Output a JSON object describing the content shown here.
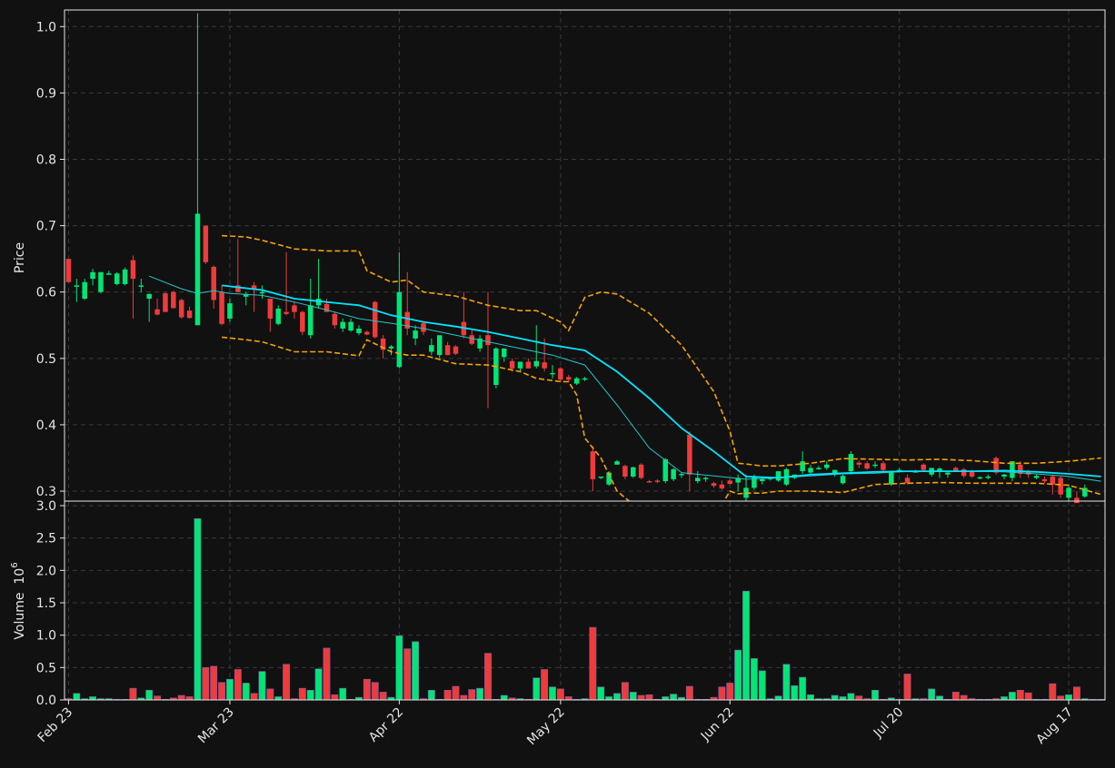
{
  "chart_data": [
    {
      "type": "candlestick",
      "panel": "price",
      "ylabel": "Price",
      "ylim": [
        0.285,
        1.025
      ],
      "yticks": [
        0.3,
        0.4,
        0.5,
        0.6,
        0.7,
        0.8,
        0.9,
        1.0
      ],
      "ytick_labels": [
        "0.3",
        "0.4",
        "0.5",
        "0.6",
        "0.7",
        "0.8",
        "0.9",
        "1.0"
      ],
      "xlim": [
        -0.5,
        128.5
      ],
      "xtick_index": [
        0,
        20,
        41,
        61,
        82,
        103,
        124
      ],
      "xtick_labels": [
        "Feb 23",
        "Mar 23",
        "Apr 22",
        "May 22",
        "Jun 22",
        "Jul 20",
        "Aug 17"
      ],
      "grid": true,
      "colors": {
        "background": "#111111",
        "up": "#00e676",
        "down": "#ef3b3b",
        "grid": "#3a3a3a",
        "frame": "#e6e6e6",
        "text": "#e6e6e6",
        "ma_fast": "#26c6c6",
        "ma_slow": "#00e5ff",
        "band": "#f5a300"
      },
      "ohlc": [
        [
          0.65,
          0.65,
          0.615,
          0.615
        ],
        [
          0.61,
          0.62,
          0.585,
          0.61
        ],
        [
          0.59,
          0.62,
          0.588,
          0.615
        ],
        [
          0.62,
          0.635,
          0.61,
          0.63
        ],
        [
          0.6,
          0.63,
          0.598,
          0.63
        ],
        [
          0.628,
          0.632,
          0.626,
          0.628
        ],
        [
          0.612,
          0.63,
          0.61,
          0.628
        ],
        [
          0.612,
          0.637,
          0.61,
          0.634
        ],
        [
          0.648,
          0.655,
          0.56,
          0.62
        ],
        [
          0.61,
          0.62,
          0.6,
          0.61
        ],
        [
          0.59,
          0.598,
          0.555,
          0.597
        ],
        [
          0.574,
          0.59,
          0.565,
          0.566
        ],
        [
          0.598,
          0.6,
          0.57,
          0.57
        ],
        [
          0.6,
          0.602,
          0.575,
          0.576
        ],
        [
          0.588,
          0.59,
          0.56,
          0.562
        ],
        [
          0.572,
          0.578,
          0.56,
          0.561
        ],
        [
          0.55,
          1.02,
          0.55,
          0.718
        ],
        [
          0.7,
          0.7,
          0.642,
          0.645
        ],
        [
          0.638,
          0.64,
          0.575,
          0.588
        ],
        [
          0.6,
          0.61,
          0.55,
          0.552
        ],
        [
          0.56,
          0.59,
          0.555,
          0.583
        ],
        [
          0.61,
          0.68,
          0.6,
          0.6
        ],
        [
          0.593,
          0.6,
          0.58,
          0.597
        ],
        [
          0.61,
          0.615,
          0.57,
          0.605
        ],
        [
          0.6,
          0.61,
          0.59,
          0.6
        ],
        [
          0.59,
          0.59,
          0.54,
          0.56
        ],
        [
          0.552,
          0.58,
          0.55,
          0.575
        ],
        [
          0.57,
          0.66,
          0.565,
          0.567
        ],
        [
          0.58,
          0.585,
          0.56,
          0.57
        ],
        [
          0.57,
          0.572,
          0.535,
          0.54
        ],
        [
          0.535,
          0.62,
          0.53,
          0.58
        ],
        [
          0.58,
          0.65,
          0.575,
          0.59
        ],
        [
          0.582,
          0.59,
          0.57,
          0.57
        ],
        [
          0.567,
          0.57,
          0.545,
          0.55
        ],
        [
          0.545,
          0.56,
          0.54,
          0.555
        ],
        [
          0.542,
          0.56,
          0.54,
          0.555
        ],
        [
          0.538,
          0.55,
          0.535,
          0.545
        ],
        [
          0.54,
          0.542,
          0.535,
          0.536
        ],
        [
          0.585,
          0.587,
          0.53,
          0.532
        ],
        [
          0.53,
          0.535,
          0.5,
          0.513
        ],
        [
          0.515,
          0.52,
          0.505,
          0.518
        ],
        [
          0.487,
          0.66,
          0.485,
          0.6
        ],
        [
          0.57,
          0.63,
          0.535,
          0.545
        ],
        [
          0.53,
          0.55,
          0.52,
          0.542
        ],
        [
          0.553,
          0.556,
          0.535,
          0.54
        ],
        [
          0.51,
          0.53,
          0.505,
          0.52
        ],
        [
          0.505,
          0.52,
          0.5,
          0.535
        ],
        [
          0.52,
          0.525,
          0.505,
          0.505
        ],
        [
          0.518,
          0.52,
          0.505,
          0.507
        ],
        [
          0.555,
          0.6,
          0.53,
          0.535
        ],
        [
          0.535,
          0.545,
          0.52,
          0.522
        ],
        [
          0.515,
          0.535,
          0.51,
          0.53
        ],
        [
          0.535,
          0.6,
          0.425,
          0.52
        ],
        [
          0.46,
          0.517,
          0.455,
          0.515
        ],
        [
          0.502,
          0.515,
          0.495,
          0.515
        ],
        [
          0.496,
          0.5,
          0.48,
          0.485
        ],
        [
          0.485,
          0.495,
          0.48,
          0.495
        ],
        [
          0.495,
          0.5,
          0.485,
          0.485
        ],
        [
          0.488,
          0.55,
          0.485,
          0.496
        ],
        [
          0.494,
          0.53,
          0.48,
          0.485
        ],
        [
          0.478,
          0.49,
          0.47,
          0.478
        ],
        [
          0.485,
          0.487,
          0.465,
          0.468
        ],
        [
          0.472,
          0.475,
          0.465,
          0.468
        ],
        [
          0.462,
          0.472,
          0.46,
          0.47
        ],
        [
          0.468,
          0.472,
          0.466,
          0.47
        ],
        [
          0.36,
          0.368,
          0.3,
          0.318
        ],
        [
          0.32,
          0.322,
          0.318,
          0.322
        ],
        [
          0.31,
          0.33,
          0.308,
          0.328
        ],
        [
          0.34,
          0.347,
          0.34,
          0.345
        ],
        [
          0.338,
          0.34,
          0.318,
          0.322
        ],
        [
          0.322,
          0.337,
          0.32,
          0.336
        ],
        [
          0.34,
          0.342,
          0.318,
          0.32
        ],
        [
          0.315,
          0.317,
          0.313,
          0.314
        ],
        [
          0.316,
          0.318,
          0.312,
          0.314
        ],
        [
          0.315,
          0.35,
          0.312,
          0.348
        ],
        [
          0.318,
          0.335,
          0.315,
          0.333
        ],
        [
          0.325,
          0.328,
          0.32,
          0.326
        ],
        [
          0.385,
          0.39,
          0.3,
          0.325
        ],
        [
          0.315,
          0.33,
          0.312,
          0.32
        ],
        [
          0.318,
          0.322,
          0.314,
          0.32
        ],
        [
          0.312,
          0.314,
          0.305,
          0.308
        ],
        [
          0.31,
          0.316,
          0.302,
          0.304
        ],
        [
          0.316,
          0.318,
          0.31,
          0.311
        ],
        [
          0.313,
          0.325,
          0.3,
          0.32
        ],
        [
          0.29,
          0.325,
          0.285,
          0.305
        ],
        [
          0.305,
          0.325,
          0.302,
          0.322
        ],
        [
          0.315,
          0.322,
          0.31,
          0.318
        ],
        [
          0.318,
          0.322,
          0.316,
          0.32
        ],
        [
          0.316,
          0.33,
          0.314,
          0.33
        ],
        [
          0.31,
          0.335,
          0.308,
          0.333
        ],
        [
          0.32,
          0.325,
          0.318,
          0.325
        ],
        [
          0.33,
          0.36,
          0.326,
          0.345
        ],
        [
          0.328,
          0.34,
          0.325,
          0.335
        ],
        [
          0.335,
          0.338,
          0.332,
          0.335
        ],
        [
          0.335,
          0.345,
          0.332,
          0.34
        ],
        [
          0.325,
          0.332,
          0.322,
          0.332
        ],
        [
          0.312,
          0.325,
          0.31,
          0.323
        ],
        [
          0.33,
          0.36,
          0.325,
          0.356
        ],
        [
          0.343,
          0.346,
          0.335,
          0.34
        ],
        [
          0.342,
          0.345,
          0.332,
          0.334
        ],
        [
          0.34,
          0.345,
          0.335,
          0.34
        ],
        [
          0.342,
          0.345,
          0.33,
          0.332
        ],
        [
          0.31,
          0.325,
          0.308,
          0.328
        ],
        [
          0.33,
          0.335,
          0.328,
          0.332
        ],
        [
          0.32,
          0.325,
          0.31,
          0.312
        ],
        [
          0.33,
          0.332,
          0.328,
          0.33
        ],
        [
          0.34,
          0.342,
          0.33,
          0.332
        ],
        [
          0.325,
          0.335,
          0.322,
          0.335
        ],
        [
          0.33,
          0.336,
          0.32,
          0.334
        ],
        [
          0.325,
          0.33,
          0.32,
          0.328
        ],
        [
          0.335,
          0.337,
          0.33,
          0.33
        ],
        [
          0.333,
          0.335,
          0.32,
          0.323
        ],
        [
          0.33,
          0.332,
          0.32,
          0.322
        ],
        [
          0.32,
          0.322,
          0.318,
          0.321
        ],
        [
          0.322,
          0.325,
          0.318,
          0.322
        ],
        [
          0.35,
          0.352,
          0.325,
          0.328
        ],
        [
          0.322,
          0.326,
          0.318,
          0.325
        ],
        [
          0.32,
          0.345,
          0.315,
          0.345
        ],
        [
          0.34,
          0.345,
          0.32,
          0.326
        ],
        [
          0.33,
          0.332,
          0.32,
          0.325
        ],
        [
          0.32,
          0.325,
          0.318,
          0.323
        ],
        [
          0.318,
          0.322,
          0.312,
          0.315
        ],
        [
          0.322,
          0.325,
          0.295,
          0.31
        ],
        [
          0.32,
          0.322,
          0.29,
          0.295
        ],
        [
          0.29,
          0.31,
          0.285,
          0.305
        ],
        [
          0.29,
          0.3,
          0.283,
          0.282
        ],
        [
          0.292,
          0.31,
          0.29,
          0.305
        ]
      ],
      "ma_fast": {
        "x": [
          10,
          14,
          16,
          18,
          20,
          24,
          28,
          32,
          36,
          40,
          44,
          48,
          52,
          56,
          60,
          64,
          68,
          72,
          76,
          80,
          84,
          88,
          92,
          96,
          100,
          104,
          108,
          112,
          116,
          120,
          124,
          128
        ],
        "y": [
          0.624,
          0.605,
          0.598,
          0.602,
          0.598,
          0.595,
          0.585,
          0.573,
          0.56,
          0.553,
          0.545,
          0.535,
          0.525,
          0.515,
          0.505,
          0.49,
          0.43,
          0.365,
          0.328,
          0.323,
          0.318,
          0.32,
          0.323,
          0.326,
          0.327,
          0.33,
          0.33,
          0.33,
          0.329,
          0.326,
          0.322,
          0.315
        ]
      },
      "ma_slow": {
        "x": [
          19,
          24,
          28,
          32,
          36,
          40,
          44,
          48,
          52,
          56,
          60,
          64,
          68,
          72,
          76,
          80,
          84,
          88,
          92,
          96,
          100,
          104,
          108,
          112,
          116,
          120,
          124,
          128
        ],
        "y": [
          0.61,
          0.603,
          0.59,
          0.585,
          0.58,
          0.565,
          0.555,
          0.548,
          0.54,
          0.53,
          0.52,
          0.512,
          0.48,
          0.44,
          0.395,
          0.36,
          0.322,
          0.32,
          0.325,
          0.327,
          0.329,
          0.33,
          0.33,
          0.33,
          0.331,
          0.329,
          0.326,
          0.322
        ]
      },
      "band_upper": {
        "x": [
          19,
          22,
          24,
          28,
          32,
          36,
          37,
          40,
          42,
          44,
          48,
          52,
          56,
          58,
          61,
          62,
          64,
          66,
          68,
          72,
          76,
          80,
          82,
          83,
          84,
          86,
          88,
          92,
          96,
          100,
          104,
          108,
          112,
          116,
          120,
          124,
          128
        ],
        "y": [
          0.685,
          0.683,
          0.678,
          0.665,
          0.662,
          0.662,
          0.632,
          0.615,
          0.618,
          0.6,
          0.594,
          0.58,
          0.572,
          0.572,
          0.555,
          0.542,
          0.592,
          0.6,
          0.597,
          0.568,
          0.52,
          0.45,
          0.39,
          0.342,
          0.341,
          0.338,
          0.338,
          0.342,
          0.349,
          0.348,
          0.347,
          0.348,
          0.346,
          0.342,
          0.342,
          0.345,
          0.35
        ]
      },
      "band_lower": {
        "x": [
          19,
          22,
          24,
          28,
          32,
          36,
          37,
          40,
          42,
          44,
          48,
          52,
          56,
          58,
          61,
          62,
          63,
          64,
          66,
          68,
          72,
          76,
          80,
          82,
          83,
          84,
          86,
          88,
          92,
          96,
          100,
          104,
          108,
          112,
          116,
          120,
          124,
          128
        ],
        "y": [
          0.532,
          0.528,
          0.525,
          0.51,
          0.51,
          0.504,
          0.528,
          0.51,
          0.505,
          0.505,
          0.492,
          0.49,
          0.48,
          0.47,
          0.465,
          0.465,
          0.445,
          0.38,
          0.35,
          0.3,
          0.26,
          0.24,
          0.26,
          0.3,
          0.296,
          0.297,
          0.297,
          0.3,
          0.3,
          0.298,
          0.31,
          0.312,
          0.313,
          0.312,
          0.312,
          0.312,
          0.309,
          0.295
        ]
      }
    },
    {
      "type": "bar",
      "panel": "volume",
      "ylabel": "Volume",
      "ylabel_exponent": "10",
      "ylabel_exponent_power": "6",
      "ylim": [
        0,
        3.07
      ],
      "yticks": [
        0,
        0.5,
        1.0,
        1.5,
        2.0,
        2.5,
        3.0
      ],
      "ytick_labels": [
        "0.0",
        "0.5",
        "1.0",
        "1.5",
        "2.0",
        "2.5",
        "3.0"
      ],
      "units": "millions",
      "values": [
        0.02,
        0.1,
        0.02,
        0.05,
        0.02,
        0.02,
        0.01,
        0.01,
        0.18,
        0.03,
        0.15,
        0.06,
        0.01,
        0.03,
        0.07,
        0.05,
        2.8,
        0.5,
        0.52,
        0.27,
        0.32,
        0.47,
        0.26,
        0.1,
        0.44,
        0.17,
        0.05,
        0.55,
        0.02,
        0.18,
        0.15,
        0.48,
        0.8,
        0.08,
        0.18,
        0.01,
        0.04,
        0.32,
        0.27,
        0.12,
        0.04,
        0.99,
        0.79,
        0.9,
        0.02,
        0.15,
        0.01,
        0.15,
        0.21,
        0.07,
        0.16,
        0.18,
        0.72,
        0.01,
        0.07,
        0.03,
        0.02,
        0.01,
        0.34,
        0.47,
        0.2,
        0.17,
        0.05,
        0.01,
        0.02,
        1.12,
        0.2,
        0.05,
        0.1,
        0.27,
        0.12,
        0.07,
        0.08,
        0.01,
        0.05,
        0.09,
        0.04,
        0.21,
        0.01,
        0.01,
        0.04,
        0.2,
        0.26,
        0.77,
        1.68,
        0.64,
        0.45,
        0.02,
        0.06,
        0.55,
        0.22,
        0.35,
        0.08,
        0.02,
        0.02,
        0.07,
        0.05,
        0.1,
        0.06,
        0.02,
        0.15,
        0.01,
        0.03,
        0.01,
        0.4,
        0.02,
        0.02,
        0.17,
        0.06,
        0.01,
        0.12,
        0.07,
        0.02,
        0.01,
        0.01,
        0.02,
        0.05,
        0.12,
        0.15,
        0.11,
        0.01,
        0.01,
        0.25,
        0.06,
        0.08,
        0.2,
        0.02,
        0.01,
        0.01
      ]
    }
  ]
}
